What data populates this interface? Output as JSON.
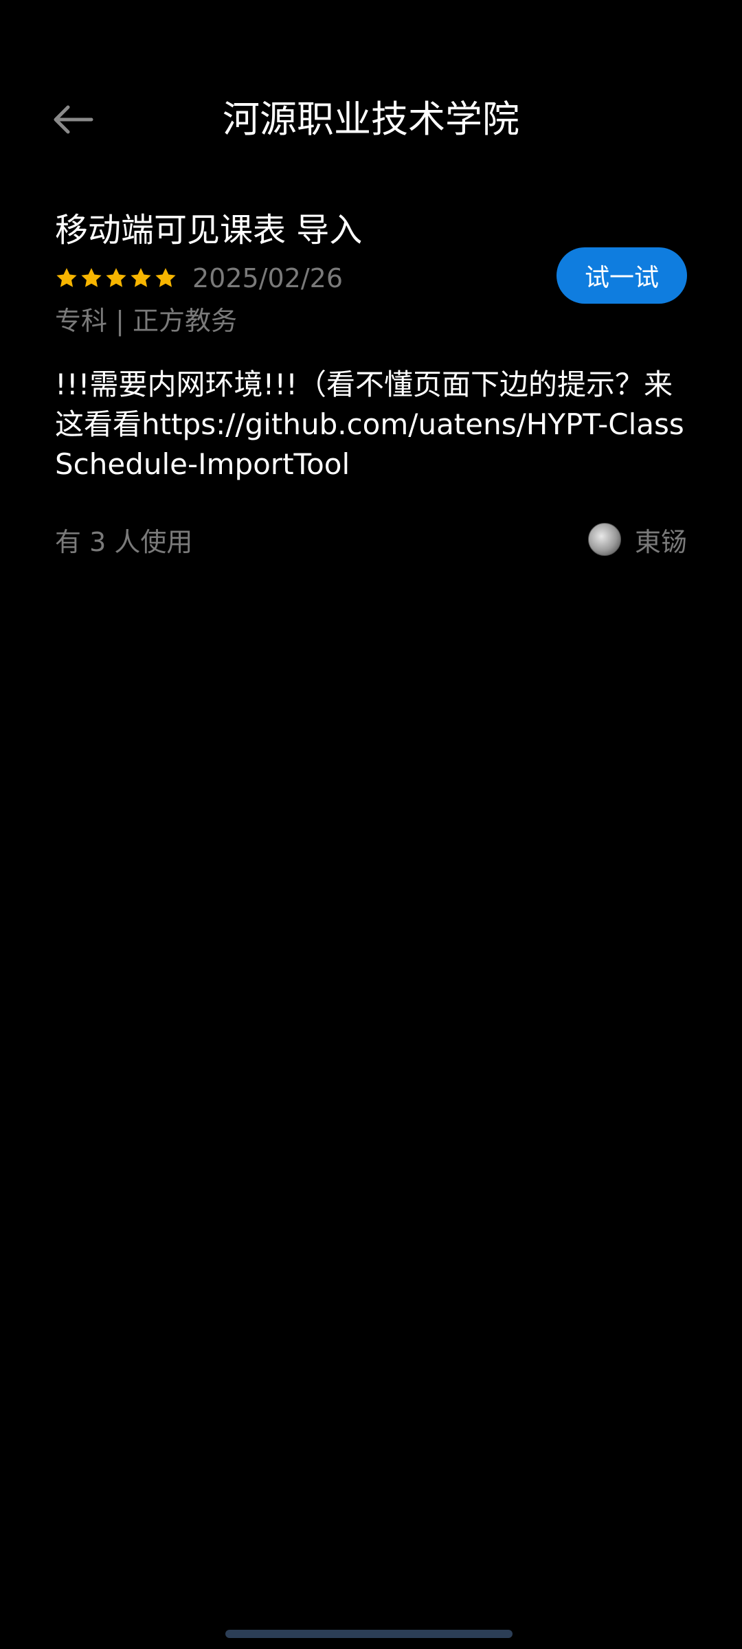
{
  "header": {
    "title": "河源职业技术学院",
    "back_icon": "arrow-left-icon"
  },
  "script": {
    "title": "移动端可见课表 导入",
    "rating": 5,
    "rating_max": 5,
    "date": "2025/02/26",
    "tags": "专科 | 正方教务",
    "try_label": "试一试",
    "description": "!!!需要内网环境!!!（看不懂页面下边的提示？来这看看https://github.com/uatens/HYPT-ClassSchedule-ImportTool",
    "usage": "有 3 人使用",
    "author": "東铴"
  },
  "colors": {
    "background": "#000000",
    "accent": "#0f7ddf",
    "star": "#f7b500",
    "muted_text": "#7a7a7a"
  }
}
